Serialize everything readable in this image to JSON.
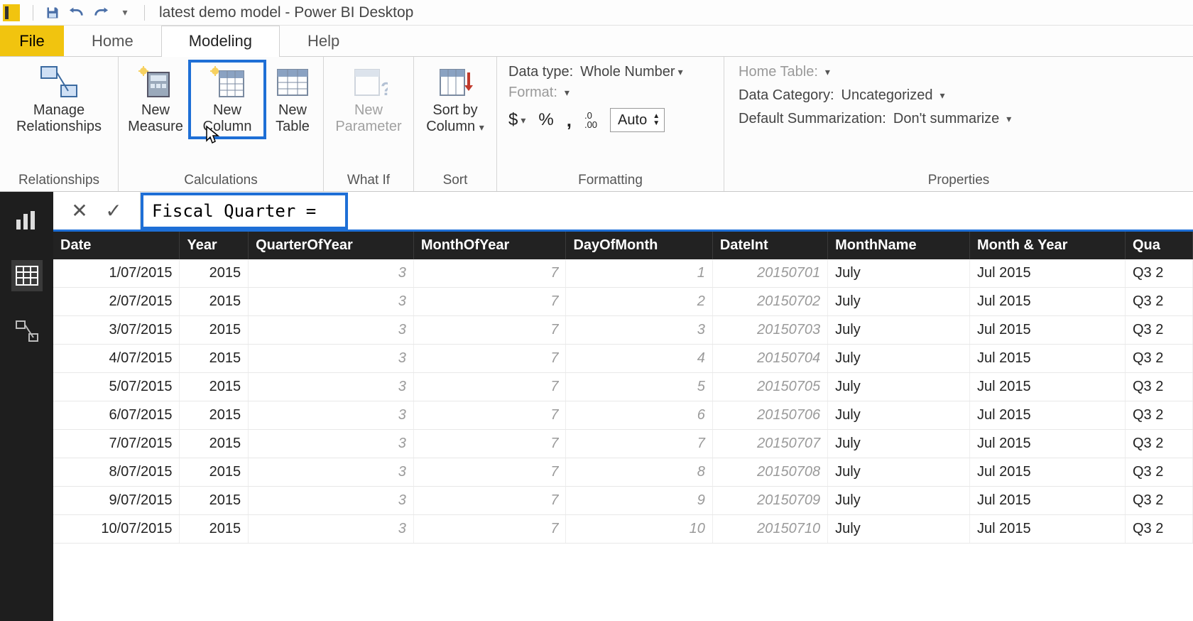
{
  "titlebar": {
    "app_title": "latest demo model - Power BI Desktop"
  },
  "ribbon_tabs": {
    "file": "File",
    "home": "Home",
    "modeling": "Modeling",
    "help": "Help",
    "active": "Modeling"
  },
  "ribbon": {
    "relationships": {
      "manage": "Manage\nRelationships",
      "group_label": "Relationships"
    },
    "calculations": {
      "new_measure": "New\nMeasure",
      "new_column": "New\nColumn",
      "new_table": "New\nTable",
      "group_label": "Calculations"
    },
    "whatif": {
      "new_parameter": "New\nParameter",
      "group_label": "What If"
    },
    "sort": {
      "sort_by_column": "Sort by\nColumn",
      "group_label": "Sort"
    },
    "formatting": {
      "data_type_label": "Data type:",
      "data_type_value": "Whole Number",
      "format_label": "Format:",
      "currency_symbol": "$",
      "percent_symbol": "%",
      "comma_symbol": ",",
      "decimals_icon": ".00",
      "decimals_value": "Auto",
      "group_label": "Formatting"
    },
    "properties": {
      "home_table_label": "Home Table:",
      "data_category_label": "Data Category:",
      "data_category_value": "Uncategorized",
      "default_summ_label": "Default Summarization:",
      "default_summ_value": "Don't summarize",
      "group_label": "Properties"
    }
  },
  "formula_bar": {
    "cancel_glyph": "✕",
    "accept_glyph": "✓",
    "expression": "Fiscal Quarter ="
  },
  "table": {
    "columns": [
      "Date",
      "Year",
      "QuarterOfYear",
      "MonthOfYear",
      "DayOfMonth",
      "DateInt",
      "MonthName",
      "Month & Year",
      "Qua"
    ],
    "col_align": [
      "r",
      "r",
      "r",
      "r",
      "r",
      "r",
      "l",
      "l",
      "l"
    ],
    "dim_cols": [
      2,
      3,
      4,
      5
    ],
    "rows": [
      [
        "1/07/2015",
        "2015",
        "3",
        "7",
        "1",
        "20150701",
        "July",
        "Jul 2015",
        "Q3 2"
      ],
      [
        "2/07/2015",
        "2015",
        "3",
        "7",
        "2",
        "20150702",
        "July",
        "Jul 2015",
        "Q3 2"
      ],
      [
        "3/07/2015",
        "2015",
        "3",
        "7",
        "3",
        "20150703",
        "July",
        "Jul 2015",
        "Q3 2"
      ],
      [
        "4/07/2015",
        "2015",
        "3",
        "7",
        "4",
        "20150704",
        "July",
        "Jul 2015",
        "Q3 2"
      ],
      [
        "5/07/2015",
        "2015",
        "3",
        "7",
        "5",
        "20150705",
        "July",
        "Jul 2015",
        "Q3 2"
      ],
      [
        "6/07/2015",
        "2015",
        "3",
        "7",
        "6",
        "20150706",
        "July",
        "Jul 2015",
        "Q3 2"
      ],
      [
        "7/07/2015",
        "2015",
        "3",
        "7",
        "7",
        "20150707",
        "July",
        "Jul 2015",
        "Q3 2"
      ],
      [
        "8/07/2015",
        "2015",
        "3",
        "7",
        "8",
        "20150708",
        "July",
        "Jul 2015",
        "Q3 2"
      ],
      [
        "9/07/2015",
        "2015",
        "3",
        "7",
        "9",
        "20150709",
        "July",
        "Jul 2015",
        "Q3 2"
      ],
      [
        "10/07/2015",
        "2015",
        "3",
        "7",
        "10",
        "20150710",
        "July",
        "Jul 2015",
        "Q3 2"
      ]
    ]
  }
}
